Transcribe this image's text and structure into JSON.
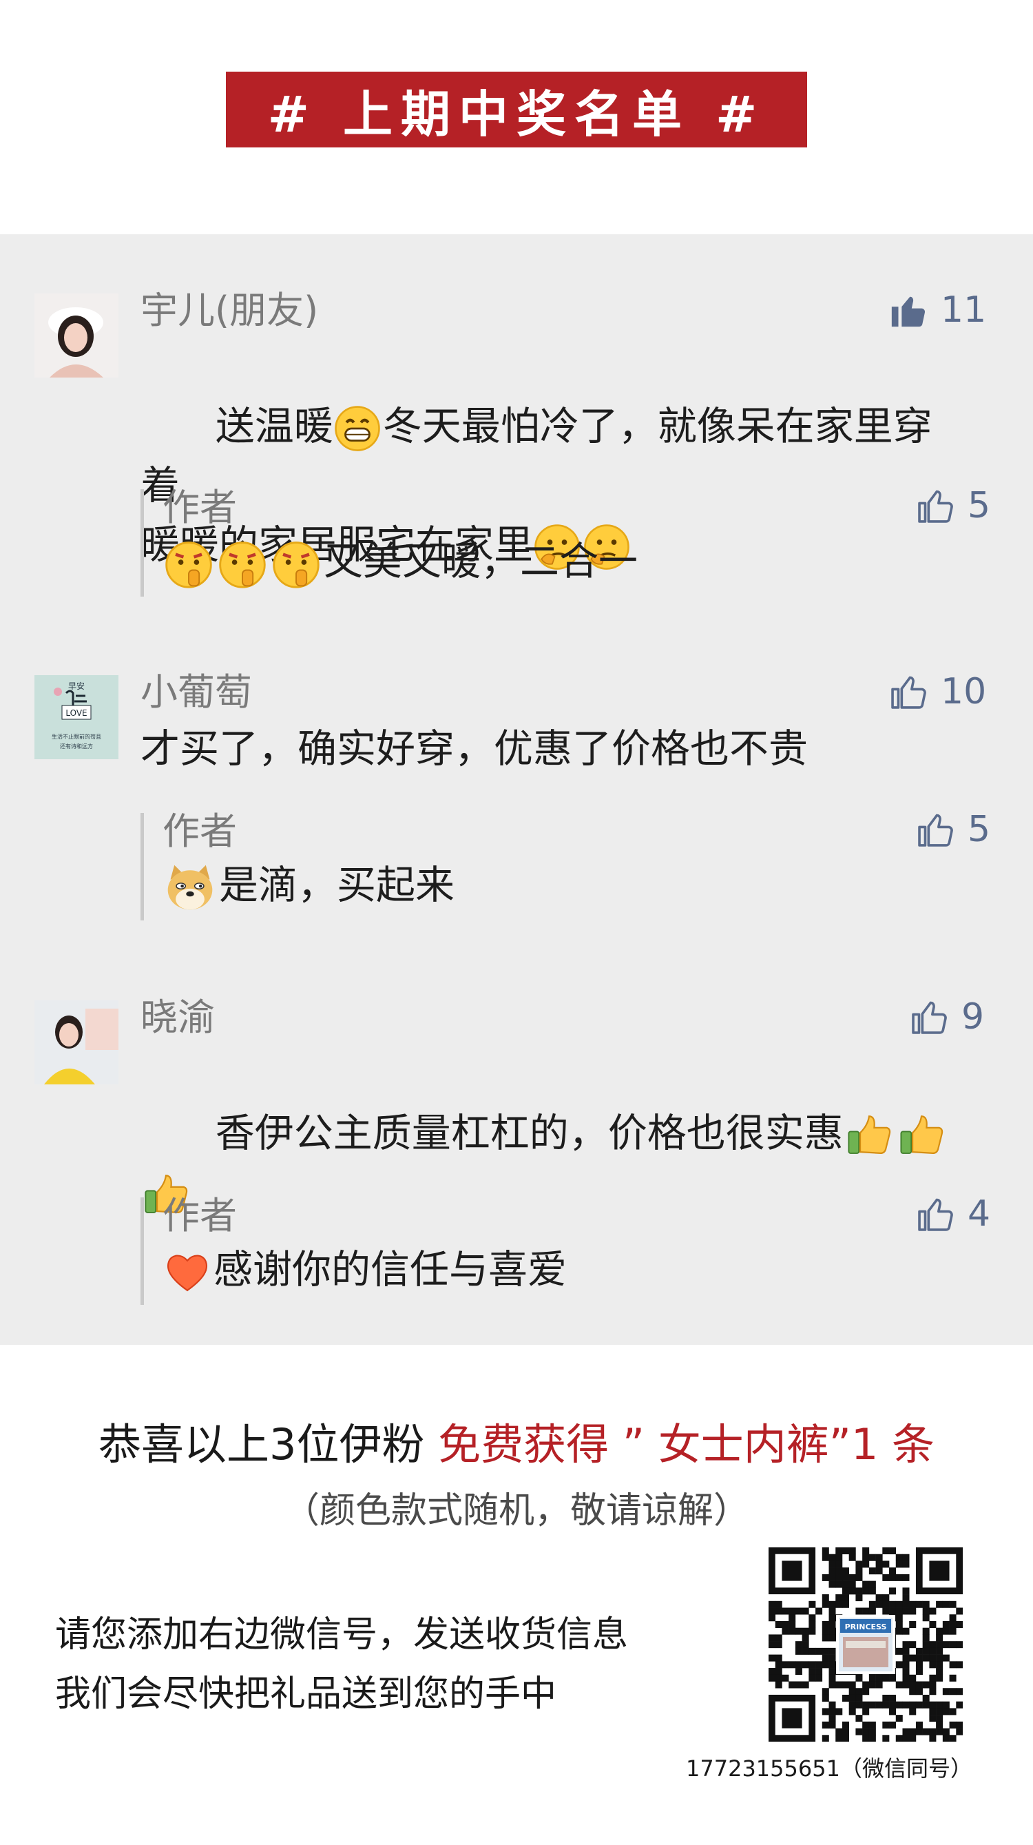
{
  "header": {
    "title": "# 上期中奖名单 #"
  },
  "comments": [
    {
      "name": "宇儿(朋友)",
      "likes": "11",
      "text_a": "送温暖",
      "text_b": "冬天最怕冷了，就像呆在家里穿着",
      "text_c": "暖暖的家居服宅在家里",
      "reply": {
        "name": "作者",
        "likes": "5",
        "text": "又美又暖，二合一"
      }
    },
    {
      "name": "小葡萄",
      "likes": "10",
      "text": "才买了，确实好穿，优惠了价格也不贵",
      "avatar_text": [
        "早安",
        "LOVE",
        "生活不止眼前的苟且",
        "还有诗和远方"
      ],
      "reply": {
        "name": "作者",
        "likes": "5",
        "text": "是滴，买起来"
      }
    },
    {
      "name": "晓渝",
      "likes": "9",
      "text": "香伊公主质量杠杠的，价格也很实惠",
      "reply": {
        "name": "作者",
        "likes": "4",
        "text": "感谢你的信任与喜爱"
      }
    }
  ],
  "prize": {
    "line_black": "恭喜以上3位伊粉 ",
    "line_red": "免费获得 ” 女士内裤”1 条",
    "note": "（颜色款式随机，敬请谅解）",
    "instruction_1": "请您添加右边微信号，发送收货信息",
    "instruction_2": "我们会尽快把礼品送到您的手中",
    "qr_label": "PRINCESS",
    "wechat_id": "17723155651（微信同号）"
  },
  "colors": {
    "banner_red": "#b52126",
    "comment_bg": "#ededed",
    "like_blue": "#5a6b8c",
    "name_gray": "#7a7a7a"
  },
  "icons": [
    "thumbs-up-filled-icon",
    "thumbs-up-outline-icon",
    "grin-emoji",
    "thinking-emoji",
    "shush-emoji",
    "doge-emoji",
    "thumbs-up-emoji",
    "heart-emoji"
  ]
}
